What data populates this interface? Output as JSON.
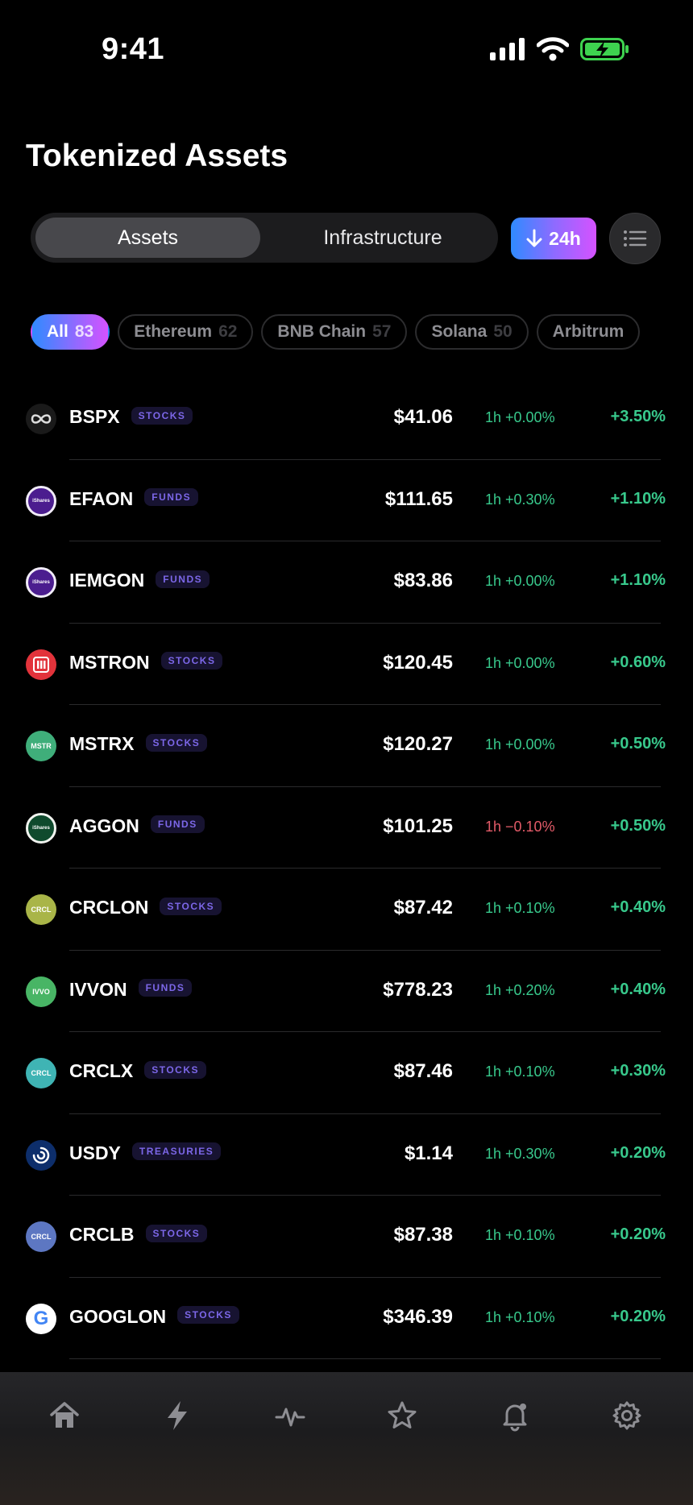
{
  "status_bar": {
    "time": "9:41"
  },
  "page": {
    "title": "Tokenized Assets"
  },
  "segments": {
    "assets": "Assets",
    "infrastructure": "Infrastructure"
  },
  "timeframe": {
    "label": "24h",
    "icon": "arrow-down-icon"
  },
  "chips": [
    {
      "label": "All",
      "count": "83",
      "active": true
    },
    {
      "label": "Ethereum",
      "count": "62"
    },
    {
      "label": "BNB Chain",
      "count": "57"
    },
    {
      "label": "Solana",
      "count": "50"
    },
    {
      "label": "Arbitrum",
      "count": ""
    }
  ],
  "assets": [
    {
      "symbol": "BSPX",
      "tag": "STOCKS",
      "price": "$41.06",
      "h1": "1h +0.00%",
      "change": "+3.50%",
      "logo_text": "",
      "logo_color": "#1a1a1a"
    },
    {
      "symbol": "EFAON",
      "tag": "FUNDS",
      "price": "$111.65",
      "h1": "1h +0.30%",
      "change": "+1.10%",
      "logo_text": "iShares",
      "logo_color": "#4b1d8f"
    },
    {
      "symbol": "IEMGON",
      "tag": "FUNDS",
      "price": "$83.86",
      "h1": "1h +0.00%",
      "change": "+1.10%",
      "logo_text": "iShares",
      "logo_color": "#4b1d8f"
    },
    {
      "symbol": "MSTRON",
      "tag": "STOCKS",
      "price": "$120.45",
      "h1": "1h +0.00%",
      "change": "+0.60%",
      "logo_text": "",
      "logo_color": "#e2333b"
    },
    {
      "symbol": "MSTRX",
      "tag": "STOCKS",
      "price": "$120.27",
      "h1": "1h +0.00%",
      "change": "+0.50%",
      "logo_text": "MSTR",
      "logo_color": "#3fae7a"
    },
    {
      "symbol": "AGGON",
      "tag": "FUNDS",
      "price": "$101.25",
      "h1": "1h −0.10%",
      "change": "+0.50%",
      "logo_text": "iShares",
      "logo_color": "#0f4a2d",
      "h1_negative": true
    },
    {
      "symbol": "CRCLON",
      "tag": "STOCKS",
      "price": "$87.42",
      "h1": "1h +0.10%",
      "change": "+0.40%",
      "logo_text": "CRCL",
      "logo_color": "#a9b548"
    },
    {
      "symbol": "IVVON",
      "tag": "FUNDS",
      "price": "$778.23",
      "h1": "1h +0.20%",
      "change": "+0.40%",
      "logo_text": "IVVO",
      "logo_color": "#48b565"
    },
    {
      "symbol": "CRCLX",
      "tag": "STOCKS",
      "price": "$87.46",
      "h1": "1h +0.10%",
      "change": "+0.30%",
      "logo_text": "CRCL",
      "logo_color": "#3fb4b4"
    },
    {
      "symbol": "USDY",
      "tag": "TREASURIES",
      "price": "$1.14",
      "h1": "1h +0.30%",
      "change": "+0.20%",
      "logo_text": "",
      "logo_color": "#0d2e6b"
    },
    {
      "symbol": "CRCLB",
      "tag": "STOCKS",
      "price": "$87.38",
      "h1": "1h +0.10%",
      "change": "+0.20%",
      "logo_text": "CRCL",
      "logo_color": "#5d77c2"
    },
    {
      "symbol": "GOOGLON",
      "tag": "STOCKS",
      "price": "$346.39",
      "h1": "1h +0.10%",
      "change": "+0.20%",
      "logo_text": "G",
      "logo_color": "#ffffff"
    }
  ],
  "tabbar": [
    "home-icon",
    "lightning-icon",
    "activity-icon",
    "star-icon",
    "bell-icon",
    "gear-icon"
  ],
  "colors": {
    "positive": "#38c98c",
    "negative": "#e35b68",
    "accent_start": "#2f8bff",
    "accent_end": "#d552ff",
    "tag_text": "#7c67e8"
  }
}
